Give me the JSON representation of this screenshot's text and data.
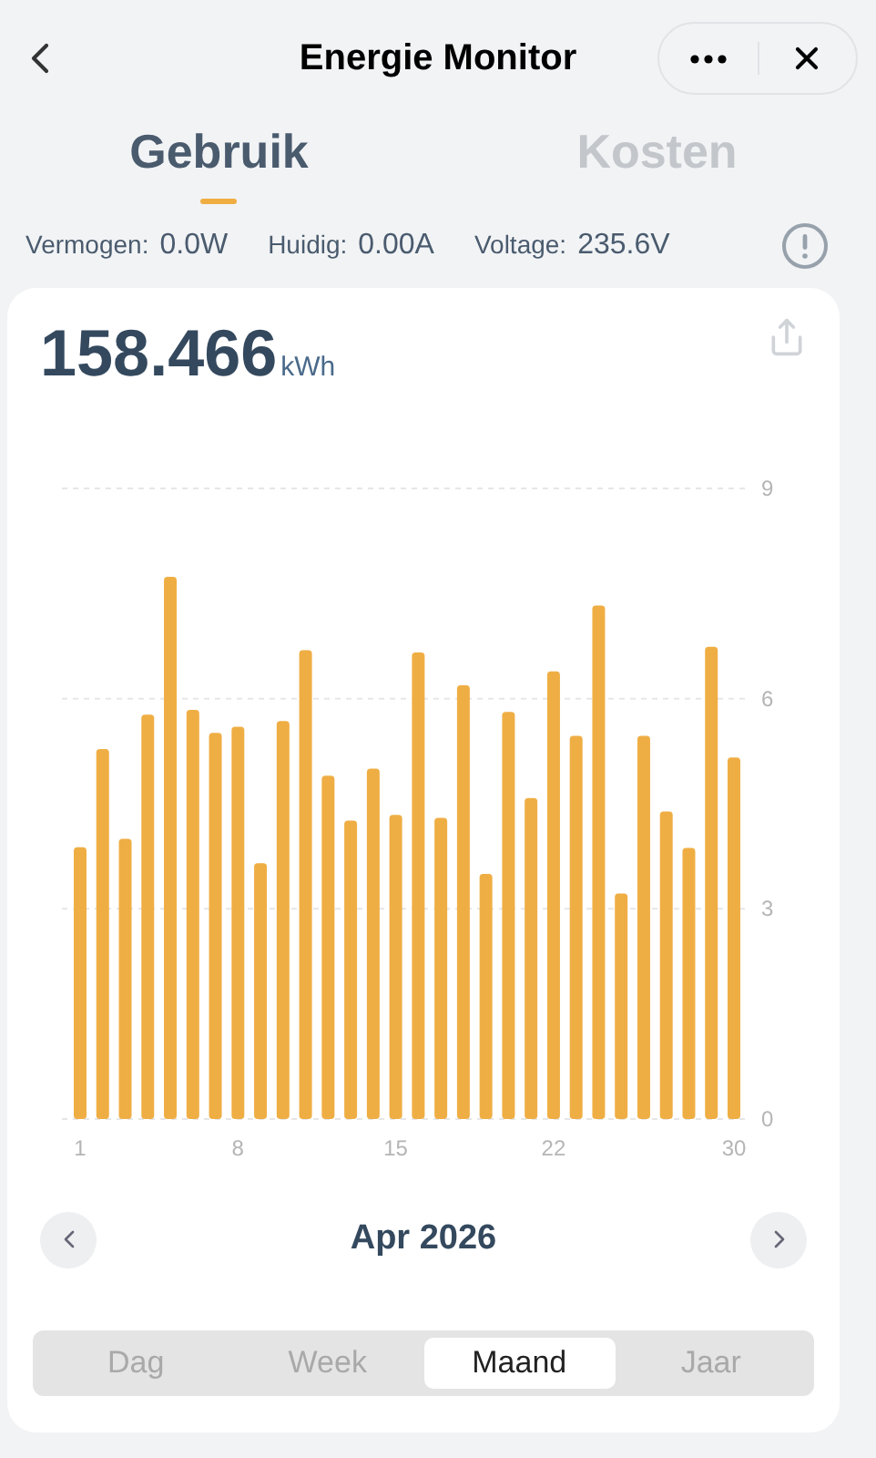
{
  "header": {
    "title": "Energie Monitor"
  },
  "tabs": [
    {
      "label": "Gebruik",
      "selected": true
    },
    {
      "label": "Kosten",
      "selected": false
    }
  ],
  "stats": [
    {
      "label": "Vermogen:",
      "value": "0.0W"
    },
    {
      "label": "Huidig:",
      "value": "0.00A"
    },
    {
      "label": "Voltage:",
      "value": "235.6V"
    }
  ],
  "total": {
    "value": "158.466",
    "unit": "kWh"
  },
  "chart_data": {
    "type": "bar",
    "x": [
      1,
      2,
      3,
      4,
      5,
      6,
      7,
      8,
      9,
      10,
      11,
      12,
      13,
      14,
      15,
      16,
      17,
      18,
      19,
      20,
      21,
      22,
      23,
      24,
      25,
      26,
      27,
      28,
      29,
      30
    ],
    "xlim": [
      1,
      30
    ],
    "xticks": [
      1,
      8,
      15,
      22,
      30
    ],
    "yticks": [
      0,
      3,
      6,
      9
    ],
    "ylim": [
      0,
      9
    ],
    "series": [
      {
        "color": "#efae44",
        "values": [
          3.88,
          5.28,
          4.0,
          5.77,
          7.74,
          5.84,
          5.51,
          5.6,
          3.65,
          5.68,
          6.69,
          4.9,
          4.26,
          5.0,
          4.34,
          6.66,
          4.3,
          6.19,
          3.5,
          5.81,
          4.58,
          6.39,
          5.47,
          7.33,
          3.22,
          5.47,
          4.39,
          3.87,
          6.74,
          5.16
        ]
      }
    ]
  },
  "period": {
    "label": "Apr 2026"
  },
  "ranges": [
    {
      "label": "Dag",
      "selected": false
    },
    {
      "label": "Week",
      "selected": false
    },
    {
      "label": "Maand",
      "selected": true
    },
    {
      "label": "Jaar",
      "selected": false
    }
  ]
}
